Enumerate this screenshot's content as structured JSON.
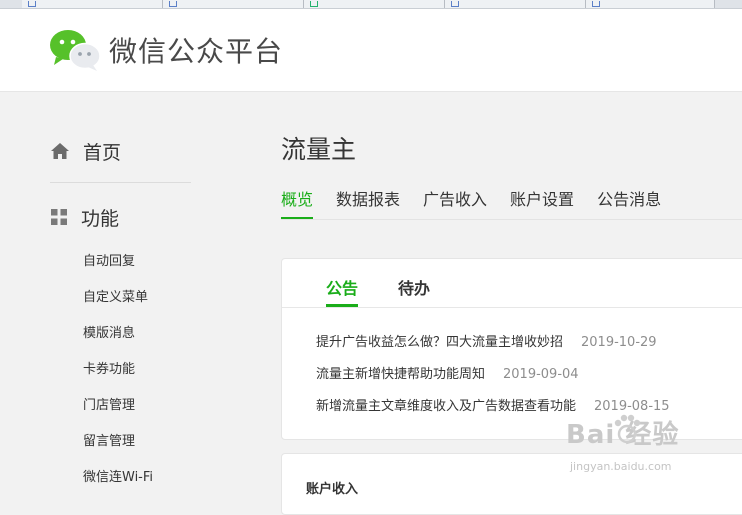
{
  "header": {
    "brand_title": "微信公众平台"
  },
  "sidebar": {
    "home_label": "首页",
    "func_label": "功能",
    "items": [
      {
        "label": "自动回复"
      },
      {
        "label": "自定义菜单"
      },
      {
        "label": "模版消息"
      },
      {
        "label": "卡券功能"
      },
      {
        "label": "门店管理"
      },
      {
        "label": "留言管理"
      },
      {
        "label": "微信连Wi-Fi"
      }
    ]
  },
  "main": {
    "title": "流量主",
    "tabs": [
      {
        "label": "概览",
        "active": true
      },
      {
        "label": "数据报表"
      },
      {
        "label": "广告收入"
      },
      {
        "label": "账户设置"
      },
      {
        "label": "公告消息"
      }
    ],
    "notice_card": {
      "tabs": [
        {
          "label": "公告",
          "active": true
        },
        {
          "label": "待办"
        }
      ],
      "notices": [
        {
          "title": "提升广告收益怎么做？四大流量主增收妙招",
          "date": "2019-10-29"
        },
        {
          "title": "流量主新增快捷帮助功能周知",
          "date": "2019-09-04"
        },
        {
          "title": "新增流量主文章维度收入及广告数据查看功能",
          "date": "2019-08-15"
        }
      ]
    },
    "account_card": {
      "heading": "账户收入"
    }
  },
  "watermark": {
    "brand": "Bai 经验",
    "url": "jingyan.baidu.com"
  },
  "colors": {
    "accent": "#1aad19",
    "text": "#353535",
    "muted": "#8d8d8d",
    "background": "#f2f2f2"
  }
}
